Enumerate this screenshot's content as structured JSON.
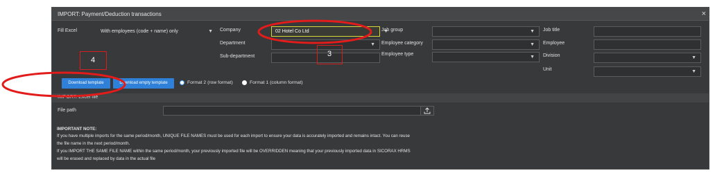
{
  "dialog": {
    "title": "IMPORT: Payment/Deduction transactions",
    "close_glyph": "×"
  },
  "filters": {
    "fill_excel": {
      "label": "Fill Excel",
      "value": "With employees (code + name) only"
    },
    "company": {
      "label": "Company",
      "value": "02 Hotel Co Ltd"
    },
    "department": {
      "label": "Department",
      "value": ""
    },
    "sub_department": {
      "label": "Sub-department",
      "value": ""
    },
    "job_group": {
      "label": "Job group",
      "value": ""
    },
    "employee_category": {
      "label": "Employee category",
      "value": ""
    },
    "employee_type": {
      "label": "Employee type",
      "value": ""
    },
    "job_title": {
      "label": "Job title",
      "value": ""
    },
    "employee": {
      "label": "Employee",
      "value": ""
    },
    "division": {
      "label": "Division",
      "value": ""
    },
    "unit": {
      "label": "Unit",
      "value": ""
    }
  },
  "actions": {
    "download_template": "Download template",
    "download_empty_template": "Download empty template",
    "format2": "Format 2 (row format)",
    "format1": "Format 1 (column format)",
    "selected_format": "format2"
  },
  "import_section": {
    "title": "IMPORT: Excel file",
    "file_path_label": "File path",
    "file_path_value": "",
    "upload_icon": "upload-icon"
  },
  "note": {
    "heading": "IMPORTANT NOTE:",
    "line1": "If you have multiple imports for the same period/month, UNIQUE FILE NAMES must be used for each import to ensure your data is accurately imported and remains intact. You can reuse",
    "line2": "the file name in the next period/month.",
    "line3": "If you IMPORT THE SAME FILE NAME within the same period/month, your previously imported file will be OVERRIDDEN meaning that your previously imported data in SICORAX HRMS",
    "line4": "will be erased and replaced by data in the actual file"
  },
  "annotations": {
    "marker_3": "3",
    "marker_4": "4",
    "color": "#e21b1b"
  }
}
